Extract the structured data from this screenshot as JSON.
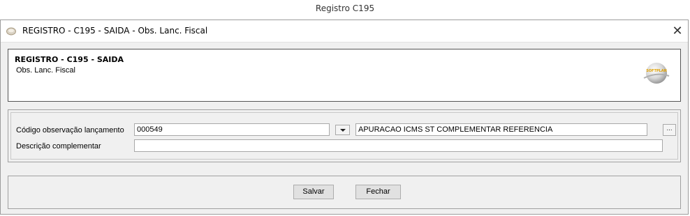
{
  "outer_title": "Registro C195",
  "window": {
    "title": "REGISTRO - C195 - SAIDA - Obs. Lanc. Fiscal",
    "icon": "app-disc-icon",
    "close_label": "✕"
  },
  "header": {
    "title": "REGISTRO - C195 - SAIDA",
    "subtitle": "Obs. Lanc. Fiscal",
    "logo": "app-logo-icon",
    "logo_text": "SOFTPLAN"
  },
  "form": {
    "codigo_label": "Código observação lançamento",
    "codigo_value": "000549",
    "codigo_description": "APURACAO ICMS ST COMPLEMENTAR REFERENCIA",
    "ellipsis_label": "...",
    "descricao_label": "Descrição complementar",
    "descricao_value": ""
  },
  "buttons": {
    "save_label": "Salvar",
    "close_label": "Fechar"
  }
}
